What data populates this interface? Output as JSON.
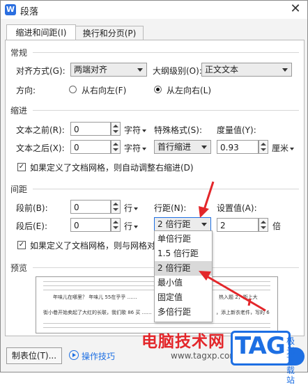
{
  "window": {
    "title": "段落",
    "app_icon_letter": "W",
    "close": "✕"
  },
  "tabs": [
    {
      "label": "缩进和间距(I)",
      "active": true
    },
    {
      "label": "换行和分页(P)",
      "active": false
    }
  ],
  "general": {
    "section": "常规",
    "alignment_label": "对齐方式(G):",
    "alignment_value": "两端对齐",
    "outline_label": "大纲级别(O):",
    "outline_value": "正文文本",
    "direction_label": "方向:",
    "rtl_label": "从右向左(F)",
    "ltr_label": "从左向右(L)"
  },
  "indent": {
    "section": "缩进",
    "before_label": "文本之前(R):",
    "before_value": "0",
    "before_unit": "字符",
    "after_label": "文本之后(X):",
    "after_value": "0",
    "after_unit": "字符",
    "special_label": "特殊格式(S):",
    "special_value": "首行缩进",
    "measure_label": "度量值(Y):",
    "measure_value": "0.93",
    "measure_unit": "厘米",
    "auto_adjust_label": "如果定义了文档网格，则自动调整右缩进(D)",
    "auto_adjust_checked": true
  },
  "spacing": {
    "section": "间距",
    "before_label": "段前(B):",
    "before_value": "0",
    "before_unit": "行",
    "after_label": "段后(E):",
    "after_value": "0",
    "after_unit": "行",
    "line_label": "行距(N):",
    "line_value": "2 倍行距",
    "setting_label": "设置值(A):",
    "setting_value": "2",
    "setting_unit": "倍",
    "grid_label": "如果定义了文档网格，则与网格对",
    "grid_checked": true
  },
  "line_spacing_options": [
    "单倍行距",
    "1.5 倍行距",
    "2 倍行距",
    "最小值",
    "固定值",
    "多倍行距"
  ],
  "preview": {
    "section": "预览",
    "sample_1": "年味儿在哪里？ 年味儿 55在乎乎 ……",
    "sample_1b": "热入题 2，街上大",
    "sample_2": "街小巷开始卖起了大红的长联，我们歌 86 买 ……",
    "sample_2b": "，添上新衣老件，写的 6"
  },
  "footer": {
    "tabs_button": "制表位(T)...",
    "tips_button": "操作技巧"
  },
  "watermark": {
    "site_name": "电脑技术网",
    "url": "www.tagxp.com",
    "tag": "TAG",
    "tag_sub": "极光下载站"
  },
  "colors": {
    "accent": "#1d6fe3",
    "arrow": "#e3262a"
  }
}
